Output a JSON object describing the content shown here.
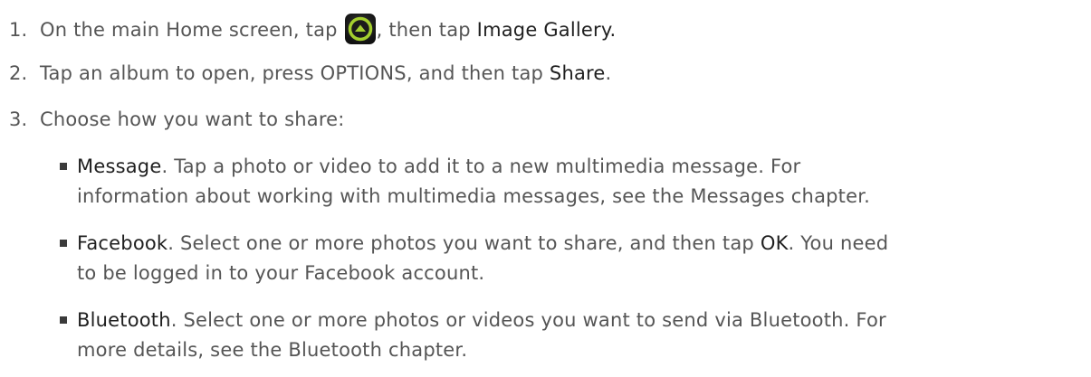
{
  "steps": [
    {
      "number": "1.",
      "text_before": "On the main Home screen, tap ",
      "icon": "all-apps-arrow-icon",
      "text_mid": ", then tap ",
      "highlight": "Image Gallery."
    },
    {
      "number": "2.",
      "text_before": "Tap an album to open, press OPTIONS, and then tap ",
      "highlight": "Share",
      "text_after": "."
    },
    {
      "number": "3.",
      "text": "Choose how you want to share:"
    }
  ],
  "share_options": [
    {
      "name": "Message",
      "line1": ". Tap a photo or video to add it to a new multimedia message. For",
      "line2": "information about working with multimedia messages, see the Messages chapter."
    },
    {
      "name": "Facebook",
      "line1_before": ". Select one or more photos you want to share, and then tap ",
      "line1_highlight": "OK",
      "line1_after": ". You need",
      "line2": "to be logged in to your Facebook account."
    },
    {
      "name": "Bluetooth",
      "line1": ". Select one or more photos or videos you want to send via Bluetooth. For",
      "line2": "more details, see the Bluetooth chapter."
    }
  ],
  "colors": {
    "body_text": "#555555",
    "highlight_text": "#1f1f1f",
    "icon_ring": "#a4cf2e",
    "icon_fill": "#1b1b1b"
  }
}
